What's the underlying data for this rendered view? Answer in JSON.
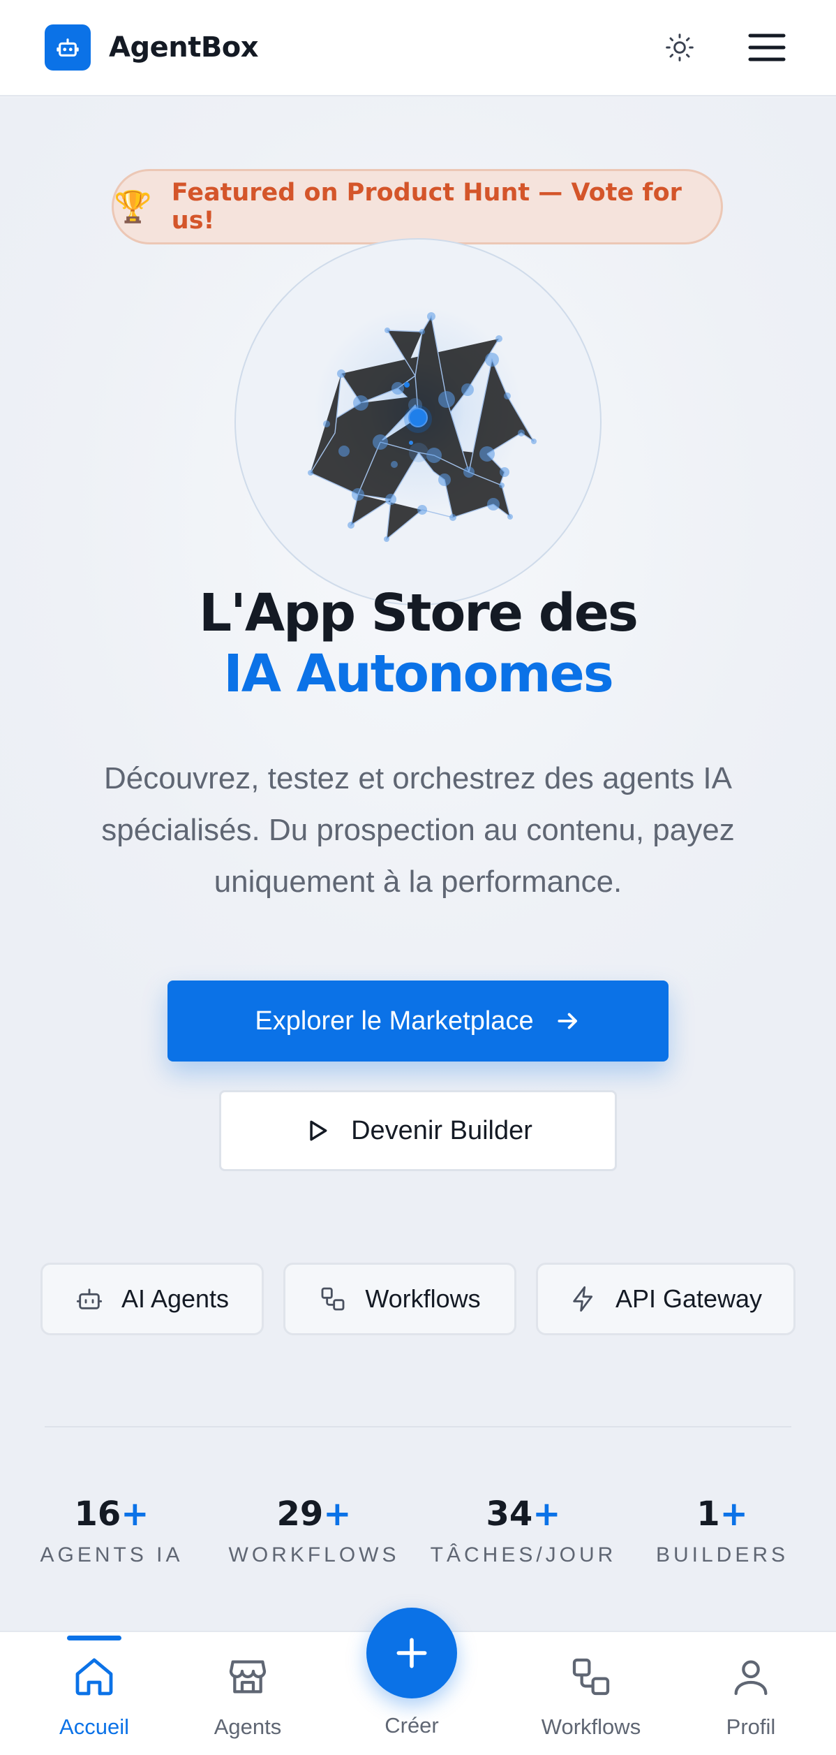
{
  "header": {
    "brand": "AgentBox",
    "logo_icon": "robot-icon",
    "theme_icon": "sun-icon",
    "menu_icon": "hamburger-menu-icon"
  },
  "hero": {
    "badge_emoji": "🏆",
    "badge_text": "Featured on Product Hunt — Vote for us!",
    "title_line1": "L'App Store des",
    "title_line2": "IA Autonomes",
    "subtitle": "Découvrez, testez et orchestrez des agents IA spécialisés. Du prospection au contenu, payez uniquement à la performance.",
    "primary_cta": "Explorer le Marketplace",
    "secondary_cta": "Devenir Builder"
  },
  "chips": [
    {
      "label": "AI Agents",
      "icon": "robot-icon"
    },
    {
      "label": "Workflows",
      "icon": "workflow-icon"
    },
    {
      "label": "API Gateway",
      "icon": "lightning-icon"
    }
  ],
  "stats": [
    {
      "value": "16",
      "suffix": "+",
      "label": "AGENTS IA"
    },
    {
      "value": "29",
      "suffix": "+",
      "label": "WORKFLOWS"
    },
    {
      "value": "34",
      "suffix": "+",
      "label": "TÂCHES/JOUR"
    },
    {
      "value": "1",
      "suffix": "+",
      "label": "BUILDERS"
    }
  ],
  "nav": {
    "items": [
      {
        "label": "Accueil",
        "icon": "home-icon",
        "active": true
      },
      {
        "label": "Agents",
        "icon": "store-icon",
        "active": false
      },
      {
        "label": "Créer",
        "icon": "plus-icon",
        "active": false
      },
      {
        "label": "Workflows",
        "icon": "workflow-icon",
        "active": false
      },
      {
        "label": "Profil",
        "icon": "user-icon",
        "active": false
      }
    ]
  },
  "colors": {
    "accent": "#0b72e7",
    "badge_text": "#d4552a",
    "text_dark": "#141a24",
    "text_muted": "#5f6673"
  }
}
